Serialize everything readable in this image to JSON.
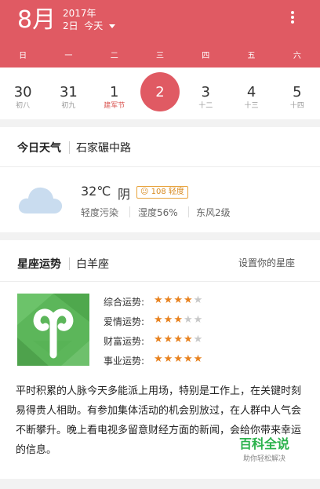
{
  "header": {
    "month": "8月",
    "year": "2017年",
    "day": "2日",
    "today_label": "今天",
    "menu_icon": "more-vertical-icon"
  },
  "weekdays": [
    "日",
    "一",
    "二",
    "三",
    "四",
    "五",
    "六"
  ],
  "dates": [
    {
      "num": "30",
      "sub": "初八"
    },
    {
      "num": "31",
      "sub": "初九"
    },
    {
      "num": "1",
      "sub": "建军节"
    },
    {
      "num": "2",
      "sub": ""
    },
    {
      "num": "3",
      "sub": "十二"
    },
    {
      "num": "4",
      "sub": "十三"
    },
    {
      "num": "5",
      "sub": "十四"
    }
  ],
  "weather": {
    "title": "今日天气",
    "location": "石家碾中路",
    "icon": "cloud-icon",
    "temperature": "32℃",
    "condition": "阴",
    "aqi_badge": "108 轻度",
    "pollution": "轻度污染",
    "humidity": "湿度56%",
    "wind": "东风2级"
  },
  "horoscope": {
    "title": "星座运势",
    "sign": "白羊座",
    "set_link": "设置你的星座",
    "sign_icon": "aries-icon",
    "fortunes": [
      {
        "label": "综合运势:",
        "stars": 4
      },
      {
        "label": "爱情运势:",
        "stars": 3
      },
      {
        "label": "财富运势:",
        "stars": 4
      },
      {
        "label": "事业运势:",
        "stars": 5
      }
    ],
    "description": "平时积累的人脉今天多能派上用场，特别是工作上，在关键时刻易得贵人相助。有参加集体活动的机会别放过，在人群中人气会不断攀升。晚上看电视多留意财经方面的新闻，会给你带来幸运的信息。"
  },
  "watermark": {
    "title": "百科全说",
    "subtitle": "助你轻松解决"
  },
  "colors": {
    "accent": "#e05a63",
    "star_on": "#e8821f",
    "star_off": "#c8c8c8",
    "sign_bg": "#5cb65a"
  }
}
